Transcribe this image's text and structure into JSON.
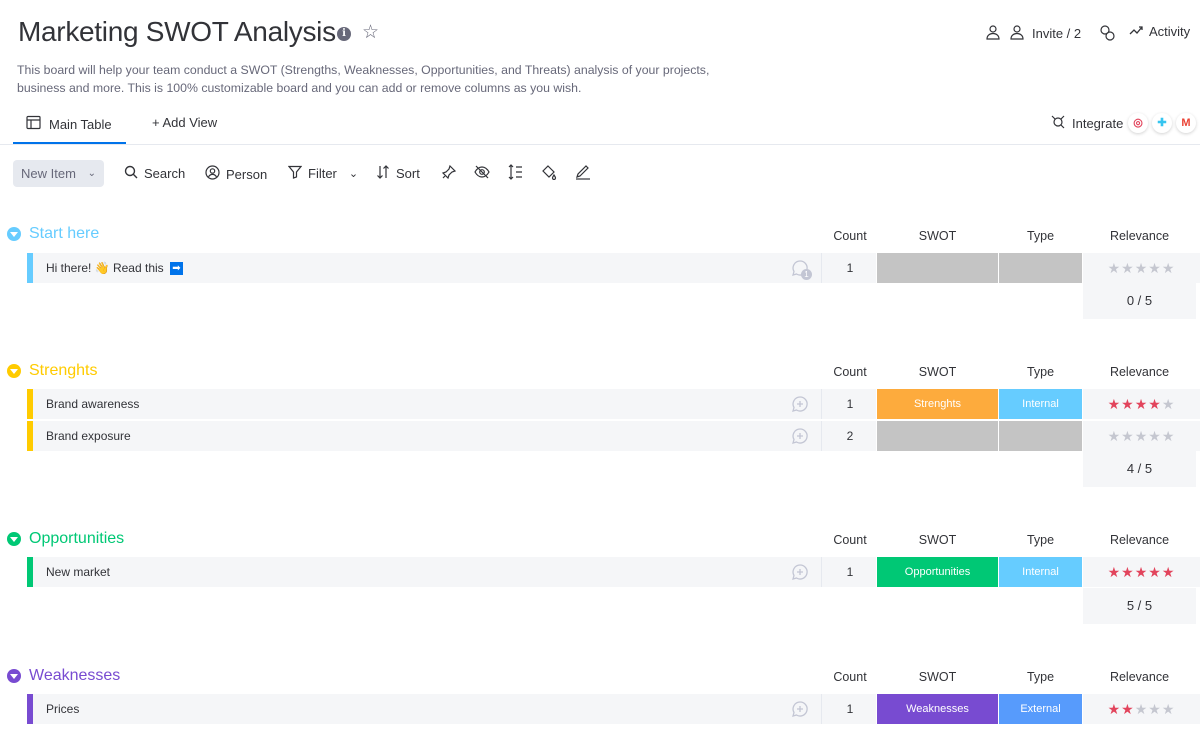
{
  "header": {
    "title": "Marketing SWOT Analysis",
    "invite_label": "Invite / 2",
    "activity_label": "Activity",
    "description": "This board will help your team conduct a SWOT (Strengths, Weaknesses, Opportunities, and Threats) analysis of your projects, business and more. This is 100% customizable board and you can add or remove columns as you wish."
  },
  "tabs": {
    "main_table": "Main Table",
    "add_view": "+ Add View",
    "integrate": "Integrate"
  },
  "toolbar": {
    "new_item": "New Item",
    "search": "Search",
    "person": "Person",
    "filter": "Filter",
    "sort": "Sort"
  },
  "columns": {
    "count": "Count",
    "swot": "SWOT",
    "type": "Type",
    "relevance": "Relevance"
  },
  "groups": [
    {
      "name": "Start here",
      "color": "#66ccff",
      "summary": "0 / 5",
      "rows": [
        {
          "name": "Hi there! 👋 Read this",
          "count": "1",
          "swot": "",
          "swot_color": "#c4c4c4",
          "type": "",
          "type_color": "#c4c4c4",
          "rating": 0
        }
      ]
    },
    {
      "name": "Strenghts",
      "color": "#ffcb00",
      "summary": "4 / 5",
      "rows": [
        {
          "name": "Brand awareness",
          "count": "1",
          "swot": "Strenghts",
          "swot_color": "#fdab3d",
          "type": "Internal",
          "type_color": "#66ccff",
          "rating": 4
        },
        {
          "name": "Brand exposure",
          "count": "2",
          "swot": "",
          "swot_color": "#c4c4c4",
          "type": "",
          "type_color": "#c4c4c4",
          "rating": 0
        }
      ]
    },
    {
      "name": "Opportunities",
      "color": "#00c875",
      "summary": "5 / 5",
      "rows": [
        {
          "name": "New market",
          "count": "1",
          "swot": "Opportunities",
          "swot_color": "#00c875",
          "type": "Internal",
          "type_color": "#66ccff",
          "rating": 5
        }
      ]
    },
    {
      "name": "Weaknesses",
      "color": "#784bd1",
      "summary": "",
      "rows": [
        {
          "name": "Prices",
          "count": "1",
          "swot": "Weaknesses",
          "swot_color": "#784bd1",
          "type": "External",
          "type_color": "#579bfc",
          "rating": 2
        }
      ]
    }
  ]
}
